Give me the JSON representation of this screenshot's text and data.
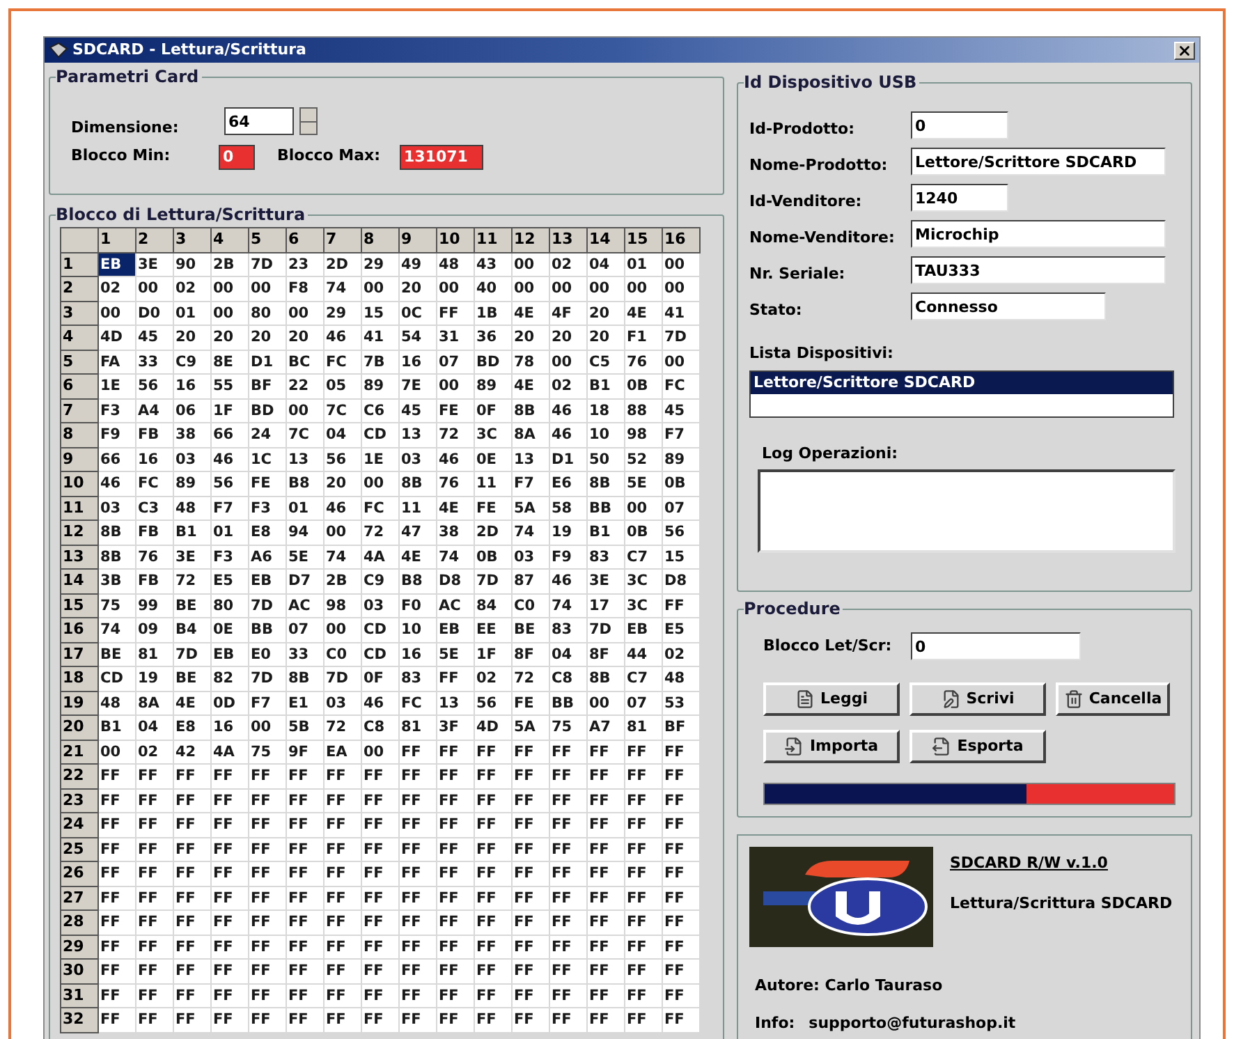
{
  "window": {
    "title": "SDCARD - Lettura/Scrittura"
  },
  "card_params": {
    "title": "Parametri Card",
    "size": {
      "label": "Dimensione:",
      "value": "64"
    },
    "block_min": {
      "label": "Blocco Min:",
      "value": "0"
    },
    "block_max": {
      "label": "Blocco Max:",
      "value": "131071"
    }
  },
  "grid": {
    "title": "Blocco di Lettura/Scrittura",
    "columns": [
      "1",
      "2",
      "3",
      "4",
      "5",
      "6",
      "7",
      "8",
      "9",
      "10",
      "11",
      "12",
      "13",
      "14",
      "15",
      "16"
    ],
    "rows": [
      {
        "label": "1",
        "cells": [
          "EB",
          "3E",
          "90",
          "2B",
          "7D",
          "23",
          "2D",
          "29",
          "49",
          "48",
          "43",
          "00",
          "02",
          "04",
          "01",
          "00"
        ],
        "selected": [
          true,
          false,
          false,
          false,
          false,
          false,
          false,
          false,
          false,
          false,
          false,
          false,
          false,
          false,
          false,
          false
        ]
      },
      {
        "label": "2",
        "cells": [
          "02",
          "00",
          "02",
          "00",
          "00",
          "F8",
          "74",
          "00",
          "20",
          "00",
          "40",
          "00",
          "00",
          "00",
          "00",
          "00"
        ],
        "selected": [
          false,
          false,
          false,
          false,
          false,
          false,
          false,
          false,
          false,
          false,
          false,
          false,
          false,
          false,
          false,
          false
        ]
      },
      {
        "label": "3",
        "cells": [
          "00",
          "D0",
          "01",
          "00",
          "80",
          "00",
          "29",
          "15",
          "0C",
          "FF",
          "1B",
          "4E",
          "4F",
          "20",
          "4E",
          "41"
        ],
        "selected": [
          false,
          false,
          false,
          false,
          false,
          false,
          false,
          false,
          false,
          false,
          false,
          false,
          false,
          false,
          false,
          false
        ]
      },
      {
        "label": "4",
        "cells": [
          "4D",
          "45",
          "20",
          "20",
          "20",
          "20",
          "46",
          "41",
          "54",
          "31",
          "36",
          "20",
          "20",
          "20",
          "F1",
          "7D"
        ],
        "selected": [
          false,
          false,
          false,
          false,
          false,
          false,
          false,
          false,
          false,
          false,
          false,
          false,
          false,
          false,
          false,
          false
        ]
      },
      {
        "label": "5",
        "cells": [
          "FA",
          "33",
          "C9",
          "8E",
          "D1",
          "BC",
          "FC",
          "7B",
          "16",
          "07",
          "BD",
          "78",
          "00",
          "C5",
          "76",
          "00"
        ],
        "selected": [
          false,
          false,
          false,
          false,
          false,
          false,
          false,
          false,
          false,
          false,
          false,
          false,
          false,
          false,
          false,
          false
        ]
      },
      {
        "label": "6",
        "cells": [
          "1E",
          "56",
          "16",
          "55",
          "BF",
          "22",
          "05",
          "89",
          "7E",
          "00",
          "89",
          "4E",
          "02",
          "B1",
          "0B",
          "FC"
        ],
        "selected": [
          false,
          false,
          false,
          false,
          false,
          false,
          false,
          false,
          false,
          false,
          false,
          false,
          false,
          false,
          false,
          false
        ]
      },
      {
        "label": "7",
        "cells": [
          "F3",
          "A4",
          "06",
          "1F",
          "BD",
          "00",
          "7C",
          "C6",
          "45",
          "FE",
          "0F",
          "8B",
          "46",
          "18",
          "88",
          "45"
        ],
        "selected": [
          false,
          false,
          false,
          false,
          false,
          false,
          false,
          false,
          false,
          false,
          false,
          false,
          false,
          false,
          false,
          false
        ]
      },
      {
        "label": "8",
        "cells": [
          "F9",
          "FB",
          "38",
          "66",
          "24",
          "7C",
          "04",
          "CD",
          "13",
          "72",
          "3C",
          "8A",
          "46",
          "10",
          "98",
          "F7"
        ],
        "selected": [
          false,
          false,
          false,
          false,
          false,
          false,
          false,
          false,
          false,
          false,
          false,
          false,
          false,
          false,
          false,
          false
        ]
      },
      {
        "label": "9",
        "cells": [
          "66",
          "16",
          "03",
          "46",
          "1C",
          "13",
          "56",
          "1E",
          "03",
          "46",
          "0E",
          "13",
          "D1",
          "50",
          "52",
          "89"
        ],
        "selected": [
          false,
          false,
          false,
          false,
          false,
          false,
          false,
          false,
          false,
          false,
          false,
          false,
          false,
          false,
          false,
          false
        ]
      },
      {
        "label": "10",
        "cells": [
          "46",
          "FC",
          "89",
          "56",
          "FE",
          "B8",
          "20",
          "00",
          "8B",
          "76",
          "11",
          "F7",
          "E6",
          "8B",
          "5E",
          "0B"
        ],
        "selected": [
          false,
          false,
          false,
          false,
          false,
          false,
          false,
          false,
          false,
          false,
          false,
          false,
          false,
          false,
          false,
          false
        ]
      },
      {
        "label": "11",
        "cells": [
          "03",
          "C3",
          "48",
          "F7",
          "F3",
          "01",
          "46",
          "FC",
          "11",
          "4E",
          "FE",
          "5A",
          "58",
          "BB",
          "00",
          "07"
        ],
        "selected": [
          false,
          false,
          false,
          false,
          false,
          false,
          false,
          false,
          false,
          false,
          false,
          false,
          false,
          false,
          false,
          false
        ]
      },
      {
        "label": "12",
        "cells": [
          "8B",
          "FB",
          "B1",
          "01",
          "E8",
          "94",
          "00",
          "72",
          "47",
          "38",
          "2D",
          "74",
          "19",
          "B1",
          "0B",
          "56"
        ],
        "selected": [
          false,
          false,
          false,
          false,
          false,
          false,
          false,
          false,
          false,
          false,
          false,
          false,
          false,
          false,
          false,
          false
        ]
      },
      {
        "label": "13",
        "cells": [
          "8B",
          "76",
          "3E",
          "F3",
          "A6",
          "5E",
          "74",
          "4A",
          "4E",
          "74",
          "0B",
          "03",
          "F9",
          "83",
          "C7",
          "15"
        ],
        "selected": [
          false,
          false,
          false,
          false,
          false,
          false,
          false,
          false,
          false,
          false,
          false,
          false,
          false,
          false,
          false,
          false
        ]
      },
      {
        "label": "14",
        "cells": [
          "3B",
          "FB",
          "72",
          "E5",
          "EB",
          "D7",
          "2B",
          "C9",
          "B8",
          "D8",
          "7D",
          "87",
          "46",
          "3E",
          "3C",
          "D8"
        ],
        "selected": [
          false,
          false,
          false,
          false,
          false,
          false,
          false,
          false,
          false,
          false,
          false,
          false,
          false,
          false,
          false,
          false
        ]
      },
      {
        "label": "15",
        "cells": [
          "75",
          "99",
          "BE",
          "80",
          "7D",
          "AC",
          "98",
          "03",
          "F0",
          "AC",
          "84",
          "C0",
          "74",
          "17",
          "3C",
          "FF"
        ],
        "selected": [
          false,
          false,
          false,
          false,
          false,
          false,
          false,
          false,
          false,
          false,
          false,
          false,
          false,
          false,
          false,
          false
        ]
      },
      {
        "label": "16",
        "cells": [
          "74",
          "09",
          "B4",
          "0E",
          "BB",
          "07",
          "00",
          "CD",
          "10",
          "EB",
          "EE",
          "BE",
          "83",
          "7D",
          "EB",
          "E5"
        ],
        "selected": [
          false,
          false,
          false,
          false,
          false,
          false,
          false,
          false,
          false,
          false,
          false,
          false,
          false,
          false,
          false,
          false
        ]
      },
      {
        "label": "17",
        "cells": [
          "BE",
          "81",
          "7D",
          "EB",
          "E0",
          "33",
          "C0",
          "CD",
          "16",
          "5E",
          "1F",
          "8F",
          "04",
          "8F",
          "44",
          "02"
        ],
        "selected": [
          false,
          false,
          false,
          false,
          false,
          false,
          false,
          false,
          false,
          false,
          false,
          false,
          false,
          false,
          false,
          false
        ]
      },
      {
        "label": "18",
        "cells": [
          "CD",
          "19",
          "BE",
          "82",
          "7D",
          "8B",
          "7D",
          "0F",
          "83",
          "FF",
          "02",
          "72",
          "C8",
          "8B",
          "C7",
          "48"
        ],
        "selected": [
          false,
          false,
          false,
          false,
          false,
          false,
          false,
          false,
          false,
          false,
          false,
          false,
          false,
          false,
          false,
          false
        ]
      },
      {
        "label": "19",
        "cells": [
          "48",
          "8A",
          "4E",
          "0D",
          "F7",
          "E1",
          "03",
          "46",
          "FC",
          "13",
          "56",
          "FE",
          "BB",
          "00",
          "07",
          "53"
        ],
        "selected": [
          false,
          false,
          false,
          false,
          false,
          false,
          false,
          false,
          false,
          false,
          false,
          false,
          false,
          false,
          false,
          false
        ]
      },
      {
        "label": "20",
        "cells": [
          "B1",
          "04",
          "E8",
          "16",
          "00",
          "5B",
          "72",
          "C8",
          "81",
          "3F",
          "4D",
          "5A",
          "75",
          "A7",
          "81",
          "BF"
        ],
        "selected": [
          false,
          false,
          false,
          false,
          false,
          false,
          false,
          false,
          false,
          false,
          false,
          false,
          false,
          false,
          false,
          false
        ]
      },
      {
        "label": "21",
        "cells": [
          "00",
          "02",
          "42",
          "4A",
          "75",
          "9F",
          "EA",
          "00",
          "FF",
          "FF",
          "FF",
          "FF",
          "FF",
          "FF",
          "FF",
          "FF"
        ],
        "selected": [
          false,
          false,
          false,
          false,
          false,
          false,
          false,
          false,
          false,
          false,
          false,
          false,
          false,
          false,
          false,
          false
        ]
      },
      {
        "label": "22",
        "cells": [
          "FF",
          "FF",
          "FF",
          "FF",
          "FF",
          "FF",
          "FF",
          "FF",
          "FF",
          "FF",
          "FF",
          "FF",
          "FF",
          "FF",
          "FF",
          "FF"
        ],
        "selected": [
          false,
          false,
          false,
          false,
          false,
          false,
          false,
          false,
          false,
          false,
          false,
          false,
          false,
          false,
          false,
          false
        ]
      },
      {
        "label": "23",
        "cells": [
          "FF",
          "FF",
          "FF",
          "FF",
          "FF",
          "FF",
          "FF",
          "FF",
          "FF",
          "FF",
          "FF",
          "FF",
          "FF",
          "FF",
          "FF",
          "FF"
        ],
        "selected": [
          false,
          false,
          false,
          false,
          false,
          false,
          false,
          false,
          false,
          false,
          false,
          false,
          false,
          false,
          false,
          false
        ]
      },
      {
        "label": "24",
        "cells": [
          "FF",
          "FF",
          "FF",
          "FF",
          "FF",
          "FF",
          "FF",
          "FF",
          "FF",
          "FF",
          "FF",
          "FF",
          "FF",
          "FF",
          "FF",
          "FF"
        ],
        "selected": [
          false,
          false,
          false,
          false,
          false,
          false,
          false,
          false,
          false,
          false,
          false,
          false,
          false,
          false,
          false,
          false
        ]
      },
      {
        "label": "25",
        "cells": [
          "FF",
          "FF",
          "FF",
          "FF",
          "FF",
          "FF",
          "FF",
          "FF",
          "FF",
          "FF",
          "FF",
          "FF",
          "FF",
          "FF",
          "FF",
          "FF"
        ],
        "selected": [
          false,
          false,
          false,
          false,
          false,
          false,
          false,
          false,
          false,
          false,
          false,
          false,
          false,
          false,
          false,
          false
        ]
      },
      {
        "label": "26",
        "cells": [
          "FF",
          "FF",
          "FF",
          "FF",
          "FF",
          "FF",
          "FF",
          "FF",
          "FF",
          "FF",
          "FF",
          "FF",
          "FF",
          "FF",
          "FF",
          "FF"
        ],
        "selected": [
          false,
          false,
          false,
          false,
          false,
          false,
          false,
          false,
          false,
          false,
          false,
          false,
          false,
          false,
          false,
          false
        ]
      },
      {
        "label": "27",
        "cells": [
          "FF",
          "FF",
          "FF",
          "FF",
          "FF",
          "FF",
          "FF",
          "FF",
          "FF",
          "FF",
          "FF",
          "FF",
          "FF",
          "FF",
          "FF",
          "FF"
        ],
        "selected": [
          false,
          false,
          false,
          false,
          false,
          false,
          false,
          false,
          false,
          false,
          false,
          false,
          false,
          false,
          false,
          false
        ]
      },
      {
        "label": "28",
        "cells": [
          "FF",
          "FF",
          "FF",
          "FF",
          "FF",
          "FF",
          "FF",
          "FF",
          "FF",
          "FF",
          "FF",
          "FF",
          "FF",
          "FF",
          "FF",
          "FF"
        ],
        "selected": [
          false,
          false,
          false,
          false,
          false,
          false,
          false,
          false,
          false,
          false,
          false,
          false,
          false,
          false,
          false,
          false
        ]
      },
      {
        "label": "29",
        "cells": [
          "FF",
          "FF",
          "FF",
          "FF",
          "FF",
          "FF",
          "FF",
          "FF",
          "FF",
          "FF",
          "FF",
          "FF",
          "FF",
          "FF",
          "FF",
          "FF"
        ],
        "selected": [
          false,
          false,
          false,
          false,
          false,
          false,
          false,
          false,
          false,
          false,
          false,
          false,
          false,
          false,
          false,
          false
        ]
      },
      {
        "label": "30",
        "cells": [
          "FF",
          "FF",
          "FF",
          "FF",
          "FF",
          "FF",
          "FF",
          "FF",
          "FF",
          "FF",
          "FF",
          "FF",
          "FF",
          "FF",
          "FF",
          "FF"
        ],
        "selected": [
          false,
          false,
          false,
          false,
          false,
          false,
          false,
          false,
          false,
          false,
          false,
          false,
          false,
          false,
          false,
          false
        ]
      },
      {
        "label": "31",
        "cells": [
          "FF",
          "FF",
          "FF",
          "FF",
          "FF",
          "FF",
          "FF",
          "FF",
          "FF",
          "FF",
          "FF",
          "FF",
          "FF",
          "FF",
          "FF",
          "FF"
        ],
        "selected": [
          false,
          false,
          false,
          false,
          false,
          false,
          false,
          false,
          false,
          false,
          false,
          false,
          false,
          false,
          false,
          false
        ]
      },
      {
        "label": "32",
        "cells": [
          "FF",
          "FF",
          "FF",
          "FF",
          "FF",
          "FF",
          "FF",
          "FF",
          "FF",
          "FF",
          "FF",
          "FF",
          "FF",
          "FF",
          "FF",
          "FF"
        ],
        "selected": [
          false,
          false,
          false,
          false,
          false,
          false,
          false,
          false,
          false,
          false,
          false,
          false,
          false,
          false,
          false,
          false
        ]
      }
    ]
  },
  "usb": {
    "title": "Id Dispositivo USB",
    "fields": [
      {
        "label": "Id-Prodotto:",
        "value": "0",
        "kind": "short"
      },
      {
        "label": "Nome-Prodotto:",
        "value": "Lettore/Scrittore SDCARD",
        "kind": "long"
      },
      {
        "label": "Id-Venditore:",
        "value": "1240",
        "kind": "short"
      },
      {
        "label": "Nome-Venditore:",
        "value": "Microchip",
        "kind": "long"
      },
      {
        "label": "Nr. Seriale:",
        "value": "TAU333",
        "kind": "long"
      },
      {
        "label": "Stato:",
        "value": "Connesso",
        "kind": "medium"
      }
    ],
    "device_list": {
      "label": "Lista Dispositivi:",
      "items": [
        {
          "text": "Lettore/Scrittore SDCARD",
          "selected": true
        }
      ]
    },
    "log": {
      "label": "Log Operazioni:"
    }
  },
  "procedures": {
    "title": "Procedure",
    "block": {
      "label": "Blocco Let/Scr:",
      "value": "0"
    },
    "buttons": [
      "Leggi",
      "Scrivi",
      "Cancella",
      "Importa",
      "Esporta"
    ],
    "progress": {
      "level": 0.64
    }
  },
  "about": {
    "title": "SDCARD R/W v.1.0",
    "subtitle": "Lettura/Scrittura SDCARD",
    "author": "Autore: Carlo Tauraso",
    "info_label": "Info:",
    "email": "supporto@futurashop.it"
  }
}
